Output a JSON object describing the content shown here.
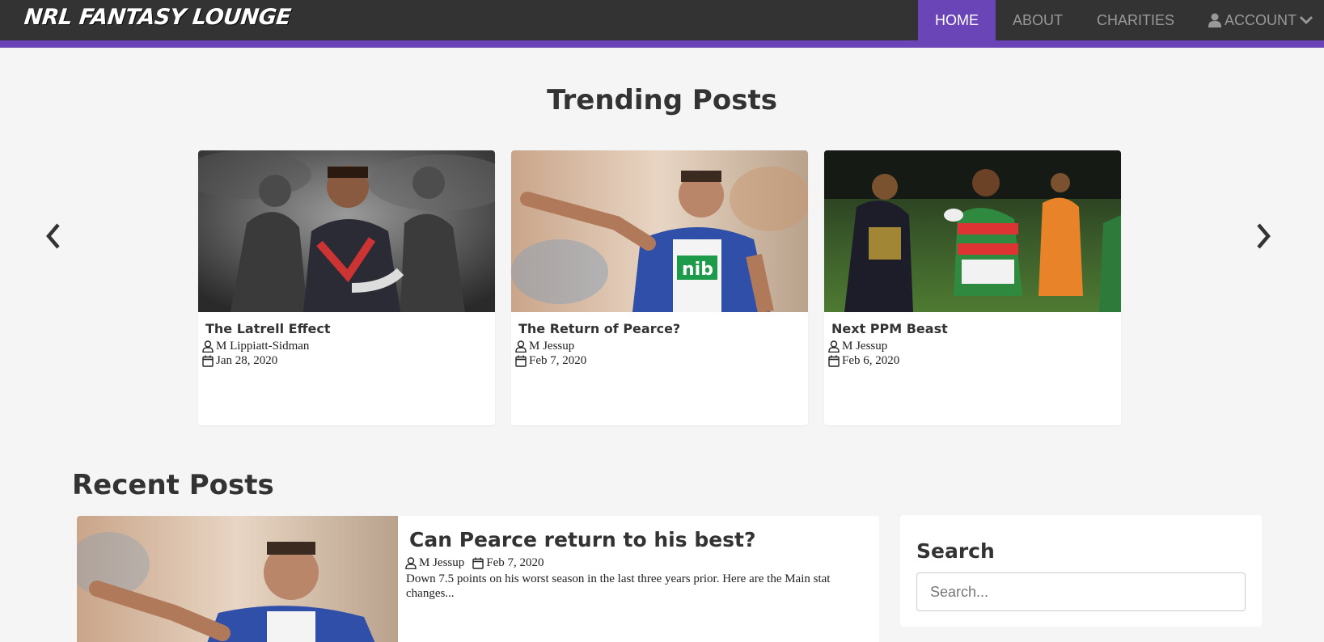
{
  "brand": "NRL FANTASY LOUNGE",
  "nav": {
    "home": "HOME",
    "about": "ABOUT",
    "charities": "CHARITIES",
    "account": "ACCOUNT"
  },
  "colors": {
    "accent": "#6a45b8",
    "navbar": "#333333"
  },
  "trending": {
    "title": "Trending Posts",
    "cards": [
      {
        "title": "The Latrell Effect",
        "author": "M Lippiatt-Sidman",
        "date": "Jan 28, 2020"
      },
      {
        "title": "The Return of Pearce?",
        "author": "M Jessup",
        "date": "Feb 7, 2020"
      },
      {
        "title": "Next PPM Beast",
        "author": "M Jessup",
        "date": "Feb 6, 2020"
      }
    ]
  },
  "recent": {
    "title": "Recent Posts",
    "post": {
      "title": "Can Pearce return to his best?",
      "author": "M Jessup",
      "date": "Feb 7, 2020",
      "excerpt": "Down 7.5 points on his worst season in the last three years prior. Here are the Main stat changes..."
    }
  },
  "search": {
    "title": "Search",
    "placeholder": "Search..."
  }
}
